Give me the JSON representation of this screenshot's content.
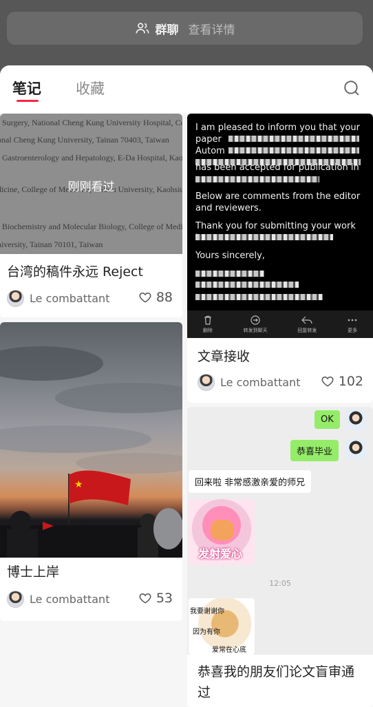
{
  "header": {
    "group_label": "群聊",
    "detail_label": "查看详情",
    "icon": "people-icon"
  },
  "tabs": [
    {
      "label": "笔记",
      "active": true
    },
    {
      "label": "收藏",
      "active": false
    }
  ],
  "search_icon": "search-icon",
  "accent_color": "#ff2442",
  "cards": [
    {
      "title": "台湾的稿件永远 Reject",
      "author": "Le combattant",
      "likes": "88",
      "overlay": "刚刚看过",
      "image_lines": [
        "f Surgery, National Cheng Kung University Hospital, Col",
        "onal Cheng Kung University, Tainan 70403, Taiwan",
        "f Gastroenterology and Hepatology, E-Da Hospital, Kaoh",
        "dicine, College of Medicine, I-Shou University, Kaohsiun",
        "f Biochemistry and Molecular Biology, College of Medic",
        "niversity, Tainan 70101, Taiwan"
      ]
    },
    {
      "title": "文章接收",
      "author": "Le combattant",
      "likes": "102",
      "image_lines": [
        "I am pleased to inform you that your",
        "paper",
        "Autom",
        "has been accepted for publication in",
        "Below are comments from the editor and reviewers.",
        "Thank you for submitting your work to",
        "Yours sincerely,"
      ],
      "toolbar": [
        "删除",
        "转发到聊天",
        "回复转发",
        "更多"
      ]
    },
    {
      "title": "博士上岸",
      "author": "Le combattant",
      "likes": "53"
    },
    {
      "title": "恭喜我的朋友们论文盲审通过",
      "chat": {
        "msg1": "OK",
        "msg2": "恭喜毕业",
        "msg3": "回来啦 非常感激亲爱的师兄",
        "sticker1_text": "发射爱心",
        "time": "12:05",
        "sticker2_line1": "我要谢谢你",
        "sticker2_line2": "因为有你",
        "sticker2_line3": "爱常在心底"
      }
    }
  ]
}
